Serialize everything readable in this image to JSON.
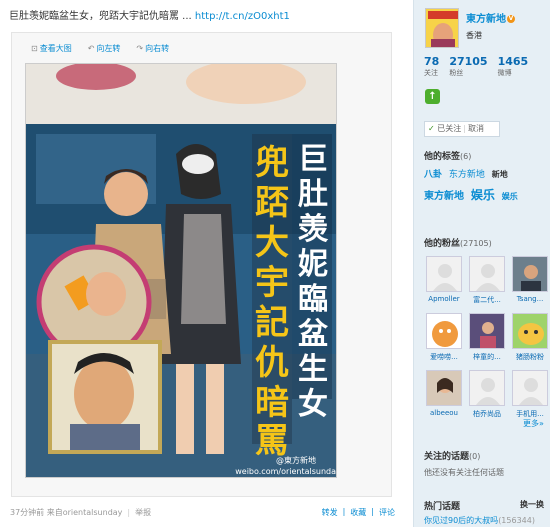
{
  "post": {
    "text": "巨肚羡妮臨盆生女，兜踎大宇記仇暗罵 ... ",
    "link": "http://t.cn/zO0xht1",
    "tools": {
      "view_large": "查看大图",
      "rotate_left": "向左转",
      "rotate_right": "向右转"
    },
    "magazine": {
      "headline_left": "兜踎大宇記仇暗罵",
      "headline_right": "巨肚羡妮臨盆生女",
      "watermark_handle": "@東方新地",
      "watermark_url": "weibo.com/orientalsunday"
    },
    "footer": {
      "time_source": "37分钟前 来自orientalsunday",
      "report": "举报",
      "actions": [
        "转发",
        "收藏",
        "评论"
      ]
    }
  },
  "profile": {
    "name": "東方新地",
    "verified_mark": "V",
    "location": "香港",
    "stats": [
      {
        "num": "78",
        "label": "关注"
      },
      {
        "num": "27105",
        "label": "粉丝"
      },
      {
        "num": "1465",
        "label": "微博"
      }
    ],
    "follow": {
      "status": "已关注",
      "cancel": "取消"
    }
  },
  "tags": {
    "title": "他的标签",
    "count": "(6)",
    "line1": [
      "八卦",
      "东方新地",
      "新地"
    ],
    "line2": [
      "東方新地",
      "娱乐",
      "娱乐"
    ]
  },
  "fans": {
    "title": "他的粉丝",
    "count": "(27105)",
    "items": [
      {
        "name": "Apmoller"
      },
      {
        "name": "富二代..."
      },
      {
        "name": "Tsang..."
      },
      {
        "name": "爱唠唠..."
      },
      {
        "name": "梓童的..."
      },
      {
        "name": "猪肠粉粉"
      },
      {
        "name": "albeeou"
      },
      {
        "name": "柏乔尚品"
      },
      {
        "name": "手机用..."
      }
    ],
    "more": "更多»"
  },
  "topics": {
    "title": "关注的话题",
    "count": "(0)",
    "empty": "他还没有关注任何话题"
  },
  "hot": {
    "title": "热门话题",
    "refresh": "换一换",
    "item": "你见过90后的大叔吗",
    "item_count": "(156344)"
  },
  "colors": {
    "link": "#0a8cd2",
    "sidebar_bg": "#e6eff5",
    "headline_yellow": "#f5c518"
  }
}
